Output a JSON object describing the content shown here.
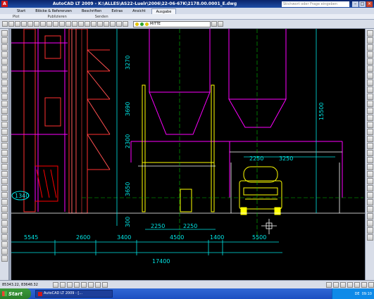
{
  "window": {
    "title": "AutoCAD LT 2009 - K:\\ALLES\\AS22-Luelr\\2006\\22-06-67K\\2178.00.0001_E.dwg",
    "search_placeholder": "Stichwort oder Frage eingeben",
    "app_icon": "autocad-logo-icon",
    "minimize_icon": "minimize-icon",
    "maximize_icon": "maximize-icon",
    "close_icon": "close-icon"
  },
  "ribbon": {
    "tabs": [
      "Start",
      "Blöcke & Referenzen",
      "Beschriften",
      "Extras",
      "Ansicht",
      "Ausgabe"
    ],
    "active_tab": "Ausgabe",
    "panels": [
      "Plot",
      "Publizieren",
      "Senden"
    ]
  },
  "toolbar": {
    "layer_name": "MITTE"
  },
  "drawing": {
    "dimensions_bottom": [
      "5545",
      "2600",
      "3400",
      "4500",
      "1400",
      "5500"
    ],
    "dimensions_sub": [
      "2250",
      "2250"
    ],
    "dimension_total": "17400",
    "dimensions_vertical": [
      "3270",
      "3690",
      "2300",
      "3650",
      "300"
    ],
    "dimension_vertical_right": "15500",
    "dimensions_upper": [
      "2250",
      "3250"
    ],
    "tag_label": "1340",
    "colors": {
      "background": "#000000",
      "structure": "#ff3030",
      "magenta": "#ff00ff",
      "yellow": "#ffff00",
      "cyan": "#00e6e6",
      "green": "#00c000",
      "white": "#ffffff"
    }
  },
  "statusbar": {
    "coordinates": "85343.22, 83648.32"
  },
  "taskbar": {
    "start_label": "Start",
    "task_label": "AutoCAD LT 2009 - [...",
    "tray_lang": "DE",
    "tray_time": "09:10"
  }
}
